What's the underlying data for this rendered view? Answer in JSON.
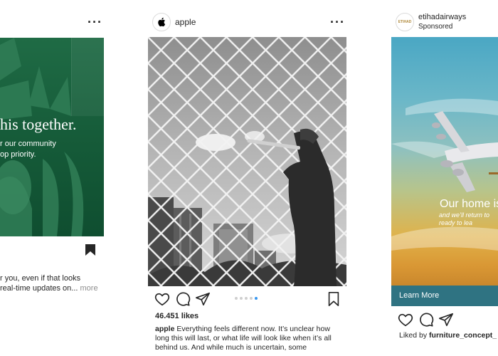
{
  "left_post": {
    "headline": "his together.",
    "subtext_line1": "r our community",
    "subtext_line2": "op priority.",
    "caption_line1": "r you, even if that looks",
    "caption_line2": "real-time updates on...",
    "more_label": "more",
    "brand_color": "#1f6b45"
  },
  "center_post": {
    "username": "apple",
    "avatar_icon": "apple-logo-icon",
    "likes": "46.451 likes",
    "caption_user": "apple",
    "caption_text": " Everything feels different now. It’s unclear how long this will last, or what life will look like when it’s all behind us. And while much is uncertain, some",
    "carousel_count": 5,
    "carousel_active_index": 4,
    "carousel_active_color": "#3897f0"
  },
  "right_post": {
    "username": "etihadairways",
    "sponsored": "Sponsored",
    "logo_text": "ETIHAD",
    "ad_headline": "Our home is",
    "ad_sub_line1": "and we’ll return to",
    "ad_sub_line2": "ready to lea",
    "cta": "Learn More",
    "cta_color": "#2f7382",
    "liked_by_prefix": "Liked by ",
    "liked_by_user": "furniture_concept_"
  },
  "icons": [
    "more-options-icon",
    "heart-icon",
    "comment-icon",
    "share-icon",
    "bookmark-icon"
  ]
}
